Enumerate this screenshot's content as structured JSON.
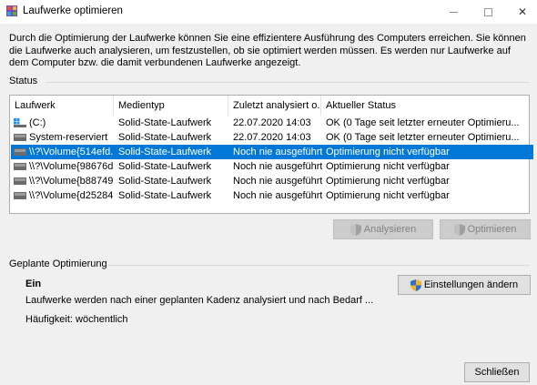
{
  "window": {
    "title": "Laufwerke optimieren",
    "minimize_icon": "minimize-icon",
    "maximize_icon": "maximize-icon",
    "close_glyph": "✕"
  },
  "intro": "Durch die Optimierung der Laufwerke können Sie eine effizientere Ausführung des Computers erreichen. Sie können die Laufwerke auch analysieren, um festzustellen, ob sie optimiert werden müssen. Es werden nur Laufwerke auf dem Computer bzw. die damit verbundenen Laufwerke angezeigt.",
  "status": {
    "label": "Status",
    "columns": [
      "Laufwerk",
      "Medientyp",
      "Zuletzt analysiert o...",
      "Aktueller Status"
    ],
    "rows": [
      {
        "drive": "(C:)",
        "media": "Solid-State-Laufwerk",
        "last": "22.07.2020 14:03",
        "state": "OK (0 Tage seit letzter erneuter Optimieru...",
        "icon": "windows-drive-icon",
        "selected": false
      },
      {
        "drive": "System-reserviert",
        "media": "Solid-State-Laufwerk",
        "last": "22.07.2020 14:03",
        "state": "OK (0 Tage seit letzter erneuter Optimieru...",
        "icon": "drive-icon",
        "selected": false
      },
      {
        "drive": "\\\\?\\Volume{514efd...",
        "media": "Solid-State-Laufwerk",
        "last": "Noch nie ausgeführt",
        "state": "Optimierung nicht verfügbar",
        "icon": "drive-icon",
        "selected": true
      },
      {
        "drive": "\\\\?\\Volume{98676d...",
        "media": "Solid-State-Laufwerk",
        "last": "Noch nie ausgeführt",
        "state": "Optimierung nicht verfügbar",
        "icon": "drive-icon",
        "selected": false
      },
      {
        "drive": "\\\\?\\Volume{b88749...",
        "media": "Solid-State-Laufwerk",
        "last": "Noch nie ausgeführt",
        "state": "Optimierung nicht verfügbar",
        "icon": "drive-icon",
        "selected": false
      },
      {
        "drive": "\\\\?\\Volume{d25284...",
        "media": "Solid-State-Laufwerk",
        "last": "Noch nie ausgeführt",
        "state": "Optimierung nicht verfügbar",
        "icon": "drive-icon",
        "selected": false
      }
    ],
    "analyze_label": "Analysieren",
    "optimize_label": "Optimieren"
  },
  "scheduled": {
    "label": "Geplante Optimierung",
    "state": "Ein",
    "description": "Laufwerke werden nach einer geplanten Kadenz analysiert und nach Bedarf ...",
    "frequency": "Häufigkeit: wöchentlich",
    "settings_label": "Einstellungen ändern"
  },
  "footer": {
    "close_label": "Schließen"
  },
  "colors": {
    "selection": "#0078d7",
    "window_bg": "#f0f0f0"
  }
}
